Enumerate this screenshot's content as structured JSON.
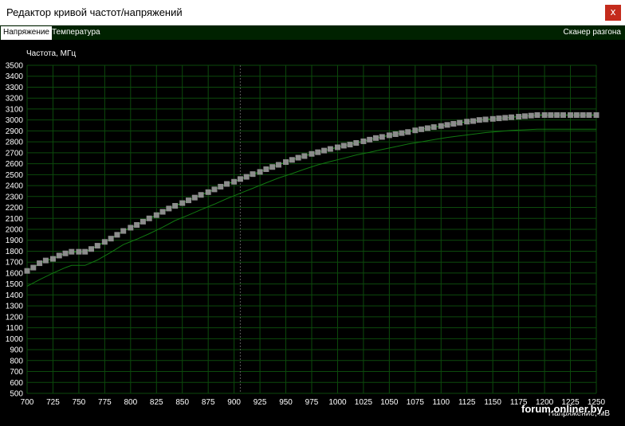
{
  "window": {
    "title": "Редактор кривой частот/напряжений",
    "close_label": "x"
  },
  "tabs": [
    {
      "label": "Напряжение",
      "active": true
    },
    {
      "label": "Температура",
      "active": false
    }
  ],
  "scanner_label": "Сканер разгона",
  "watermark": "forum.onliner.by",
  "colors": {
    "background": "#000000",
    "grid": "#0c4a0c",
    "current_curve": "#1fae1f",
    "default_curve": "#117811",
    "point": "#8c8c8c",
    "tab_bar": "#002200",
    "close_button": "#c42b1c"
  },
  "chart_data": {
    "type": "line",
    "ylabel": "Частота, МГц",
    "xlabel": "Напряжение, мВ",
    "xlim": [
      700,
      1250
    ],
    "ylim": [
      500,
      3500
    ],
    "x_ticks": [
      700,
      725,
      750,
      775,
      800,
      825,
      850,
      875,
      900,
      925,
      950,
      975,
      1000,
      1025,
      1050,
      1075,
      1100,
      1125,
      1150,
      1175,
      1200,
      1225,
      1250
    ],
    "y_ticks": [
      500,
      600,
      700,
      800,
      900,
      1000,
      1100,
      1200,
      1300,
      1400,
      1500,
      1600,
      1700,
      1800,
      1900,
      2000,
      2100,
      2200,
      2300,
      2400,
      2500,
      2600,
      2700,
      2800,
      2900,
      3000,
      3100,
      3200,
      3300,
      3400,
      3500
    ],
    "grid": true,
    "current_voltage_marker": 906,
    "series": [
      {
        "role": "curve points",
        "points": [
          [
            700,
            1620
          ],
          [
            706,
            1650
          ],
          [
            712,
            1690
          ],
          [
            718,
            1715
          ],
          [
            725,
            1730
          ],
          [
            731,
            1760
          ],
          [
            737,
            1780
          ],
          [
            743,
            1795
          ],
          [
            750,
            1795
          ],
          [
            756,
            1795
          ],
          [
            762,
            1820
          ],
          [
            768,
            1850
          ],
          [
            775,
            1885
          ],
          [
            781,
            1915
          ],
          [
            787,
            1950
          ],
          [
            793,
            1985
          ],
          [
            800,
            2015
          ],
          [
            806,
            2040
          ],
          [
            812,
            2070
          ],
          [
            818,
            2100
          ],
          [
            825,
            2130
          ],
          [
            831,
            2160
          ],
          [
            837,
            2190
          ],
          [
            843,
            2215
          ],
          [
            850,
            2240
          ],
          [
            856,
            2265
          ],
          [
            862,
            2290
          ],
          [
            868,
            2315
          ],
          [
            875,
            2340
          ],
          [
            881,
            2365
          ],
          [
            887,
            2390
          ],
          [
            893,
            2415
          ],
          [
            900,
            2435
          ],
          [
            906,
            2460
          ],
          [
            912,
            2480
          ],
          [
            918,
            2505
          ],
          [
            925,
            2525
          ],
          [
            931,
            2550
          ],
          [
            937,
            2570
          ],
          [
            943,
            2590
          ],
          [
            950,
            2615
          ],
          [
            956,
            2635
          ],
          [
            962,
            2655
          ],
          [
            968,
            2670
          ],
          [
            975,
            2690
          ],
          [
            981,
            2705
          ],
          [
            987,
            2720
          ],
          [
            993,
            2735
          ],
          [
            1000,
            2750
          ],
          [
            1006,
            2765
          ],
          [
            1012,
            2775
          ],
          [
            1018,
            2790
          ],
          [
            1025,
            2805
          ],
          [
            1031,
            2820
          ],
          [
            1037,
            2835
          ],
          [
            1043,
            2845
          ],
          [
            1050,
            2860
          ],
          [
            1056,
            2870
          ],
          [
            1062,
            2880
          ],
          [
            1068,
            2890
          ],
          [
            1075,
            2905
          ],
          [
            1081,
            2915
          ],
          [
            1087,
            2925
          ],
          [
            1093,
            2935
          ],
          [
            1100,
            2945
          ],
          [
            1106,
            2955
          ],
          [
            1112,
            2965
          ],
          [
            1118,
            2975
          ],
          [
            1125,
            2985
          ],
          [
            1131,
            2990
          ],
          [
            1137,
            3000
          ],
          [
            1143,
            3005
          ],
          [
            1150,
            3010
          ],
          [
            1156,
            3015
          ],
          [
            1162,
            3020
          ],
          [
            1168,
            3025
          ],
          [
            1175,
            3030
          ],
          [
            1181,
            3035
          ],
          [
            1187,
            3040
          ],
          [
            1193,
            3045
          ],
          [
            1200,
            3045
          ],
          [
            1206,
            3045
          ],
          [
            1212,
            3045
          ],
          [
            1218,
            3045
          ],
          [
            1225,
            3045
          ],
          [
            1231,
            3045
          ],
          [
            1237,
            3045
          ],
          [
            1243,
            3045
          ],
          [
            1250,
            3045
          ]
        ]
      },
      {
        "role": "default curve",
        "points": [
          [
            700,
            1480
          ],
          [
            712,
            1540
          ],
          [
            725,
            1600
          ],
          [
            737,
            1650
          ],
          [
            743,
            1670
          ],
          [
            756,
            1670
          ],
          [
            768,
            1720
          ],
          [
            781,
            1790
          ],
          [
            793,
            1860
          ],
          [
            806,
            1910
          ],
          [
            818,
            1960
          ],
          [
            831,
            2020
          ],
          [
            843,
            2080
          ],
          [
            856,
            2130
          ],
          [
            868,
            2180
          ],
          [
            881,
            2230
          ],
          [
            893,
            2280
          ],
          [
            906,
            2330
          ],
          [
            918,
            2375
          ],
          [
            931,
            2425
          ],
          [
            943,
            2470
          ],
          [
            956,
            2510
          ],
          [
            968,
            2550
          ],
          [
            981,
            2590
          ],
          [
            993,
            2620
          ],
          [
            1006,
            2650
          ],
          [
            1018,
            2680
          ],
          [
            1031,
            2705
          ],
          [
            1043,
            2730
          ],
          [
            1056,
            2755
          ],
          [
            1068,
            2780
          ],
          [
            1081,
            2800
          ],
          [
            1093,
            2820
          ],
          [
            1106,
            2840
          ],
          [
            1118,
            2855
          ],
          [
            1131,
            2870
          ],
          [
            1143,
            2885
          ],
          [
            1156,
            2895
          ],
          [
            1168,
            2905
          ],
          [
            1181,
            2910
          ],
          [
            1193,
            2915
          ],
          [
            1206,
            2915
          ],
          [
            1225,
            2915
          ],
          [
            1250,
            2915
          ]
        ]
      }
    ]
  }
}
